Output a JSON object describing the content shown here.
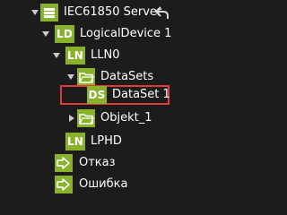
{
  "tree": {
    "server": {
      "label": "IEC61850 Server",
      "badge_icon": "server-icon",
      "undo_icon": "undo-arrow-icon"
    },
    "logical_device": {
      "badge": "LD",
      "label": "LogicalDevice 1"
    },
    "ln0": {
      "badge": "LN",
      "label": "LLN0"
    },
    "datasets_folder": {
      "label": "DataSets",
      "icon": "folder-icon"
    },
    "dataset1": {
      "badge": "DS",
      "label": "DataSet 1",
      "selected": true
    },
    "objekt_folder": {
      "label": "Objekt_1",
      "icon": "folder-icon"
    },
    "lphd": {
      "badge": "LN",
      "label": "LPHD"
    },
    "otkaz": {
      "label": "Отказ",
      "icon": "signal-output-icon"
    },
    "oshibka": {
      "label": "Ошибка",
      "icon": "signal-output-icon"
    }
  },
  "colors": {
    "accent": "#88b22c",
    "background": "#1c1c1c",
    "selection_border": "#e03a3a",
    "text": "#ffffff"
  }
}
